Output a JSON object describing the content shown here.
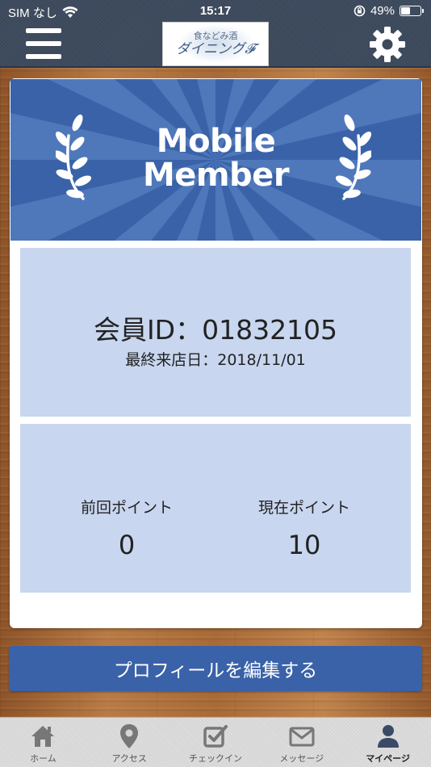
{
  "status_bar": {
    "carrier": "SIM なし",
    "time": "15:17",
    "battery_percent": "49%",
    "battery_level": 0.49
  },
  "header": {
    "logo_sub": "食などみ酒",
    "logo_main": "ダイニング𝓕"
  },
  "banner": {
    "title_line1": "Mobile",
    "title_line2": "Member"
  },
  "member": {
    "id_text": "会員ID：01832105",
    "last_visit": "最終来店日：2018/11/01"
  },
  "points": {
    "previous_label": "前回ポイント",
    "previous_value": "0",
    "current_label": "現在ポイント",
    "current_value": "10"
  },
  "actions": {
    "edit_profile": "プロフィールを編集する"
  },
  "tabs": [
    {
      "label": "ホーム",
      "icon": "home-icon"
    },
    {
      "label": "アクセス",
      "icon": "map-pin-icon"
    },
    {
      "label": "チェックイン",
      "icon": "checkbox-icon"
    },
    {
      "label": "メッセージ",
      "icon": "envelope-icon"
    },
    {
      "label": "マイページ",
      "icon": "user-icon",
      "active": true
    }
  ],
  "colors": {
    "header_bg": "#3d4a5d",
    "accent_blue": "#3a62a8",
    "panel_bg": "#c8d6ef",
    "wood": "#a9683a"
  }
}
